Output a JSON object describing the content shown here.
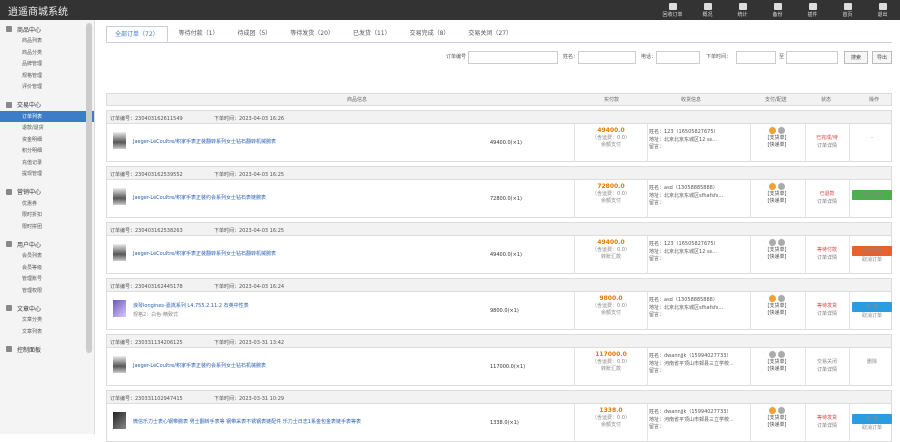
{
  "app_title": "逍遥商城系统",
  "topnav": [
    "回收订单",
    "概况",
    "统计",
    "备份",
    "插件",
    "首页",
    "退出"
  ],
  "sidebar": [
    {
      "title": "商品中心",
      "items": [
        "商品列表",
        "商品分类",
        "品牌管理",
        "规格管理",
        "评价管理"
      ]
    },
    {
      "title": "交易中心",
      "items": [
        "订单列表",
        "退款/退货",
        "资金明细",
        "积分明细",
        "充值记录",
        "提现管理"
      ]
    },
    {
      "title": "营销中心",
      "items": [
        "优惠券",
        "限时折扣",
        "限时拼团"
      ]
    },
    {
      "title": "用户中心",
      "items": [
        "会员列表",
        "会员等级",
        "管理账号",
        "管理权限"
      ]
    },
    {
      "title": "文章中心",
      "items": [
        "文章分类",
        "文章列表"
      ]
    },
    {
      "title": "控制面板",
      "items": []
    }
  ],
  "tabs": [
    "全部订单（72）",
    "等待付款（1）",
    "待成团（5）",
    "等待发货（20）",
    "已发货（11）",
    "交易完成（8）",
    "交易关闭（27）"
  ],
  "filters": {
    "order_no": "订单编号",
    "name": "姓名：",
    "phone": "电话：",
    "time": "下单时间：",
    "to": "至",
    "search": "搜索",
    "export": "导出"
  },
  "table_headers": [
    "商品信息",
    "实付款",
    "收货信息",
    "支付/配送",
    "状态",
    "操作"
  ],
  "orders": [
    {
      "no": "订单编号：230403162611549",
      "time": "下单时间：2023-04-03 16:26",
      "product": "Jaeger-LeCoultre/积家手表正装翻转系列女士钻石翻转机械腕表",
      "variant": "",
      "qty": "49400.0(×1)",
      "paid": "49400.0",
      "sub1": "（含运费：0.0）",
      "sub2": "余额支付",
      "addr": [
        "姓名：123（16505827675）",
        "地址：北京北京东城区12 ss...",
        "留言："
      ],
      "pay_icons": [
        "o",
        "g"
      ],
      "pay": [
        "[支货单]",
        "[快递单]"
      ],
      "status": "已完成/待",
      "status_sub": "订单详情",
      "op": "-",
      "op_color": "",
      "op_sub": "",
      "thumb": "w"
    },
    {
      "no": "订单编号：230403162539552",
      "time": "下单时间：2023-04-03 16:25",
      "product": "Jaeger-LeCoultre/积家手表正装约会系列女士钻石表链腕表",
      "variant": "",
      "qty": "72800.0(×1)",
      "paid": "72800.0",
      "sub1": "（含运费：0.0）",
      "sub2": "余额支付",
      "addr": [
        "姓名：asd（13058885888）",
        "地址：北京北京东城区sfhafsfs...",
        "留言："
      ],
      "pay_icons": [
        "o",
        "g"
      ],
      "pay": [
        "[支货单]",
        "[快递单]"
      ],
      "status": "已退款",
      "status_sub": "订单详情",
      "op": "确认回款",
      "op_color": "#4cae4c",
      "op_sub": "",
      "thumb": "w"
    },
    {
      "no": "订单编号：230403162538263",
      "time": "下单时间：2023-04-03 16:25",
      "product": "Jaeger-LeCoultre/积家手表正装翻转系列女士钻石翻转机械腕表",
      "variant": "",
      "qty": "49400.0(×1)",
      "paid": "49400.0",
      "sub1": "（含运费：0.0）",
      "sub2": "转账汇款",
      "addr": [
        "姓名：123（16505827675）",
        "地址：北京北京东城区12 ss...",
        "留言："
      ],
      "pay_icons": [
        "g",
        "g"
      ],
      "pay": [
        "[支货单]",
        "[快递单]"
      ],
      "status": "等待付款",
      "status_sub": "订单详情",
      "op": "立即付款",
      "op_color": "#e8602c",
      "op_sub": "取消订单",
      "thumb": "w"
    },
    {
      "no": "订单编号：230403162445178",
      "time": "下单时间：2023-04-03 16:24",
      "product": "浪琴longines-嘉岚系列 L4.755.2.11.2 石英中性表",
      "variant": "规格2：白色-精致式",
      "qty": "9800.0(×1)",
      "paid": "9800.0",
      "sub1": "（含运费：0.0）",
      "sub2": "余额支付",
      "addr": [
        "姓名：asd（13058885888）",
        "地址：北京北京东城区sfhafsfs...",
        "留言："
      ],
      "pay_icons": [
        "o",
        "g"
      ],
      "pay": [
        "[支货单]",
        "[快递单]"
      ],
      "status": "等待发货",
      "status_sub": "订单详情",
      "op": "发 货",
      "op_color": "#2a9de0",
      "op_sub": "取消订单",
      "thumb": "c"
    },
    {
      "no": "订单编号：230331134206125",
      "time": "下单时间：2023-03-31 13:42",
      "product": "Jaeger-LeCoultre/积家手表正装约会系列女士钻石机械腕表",
      "variant": "",
      "qty": "117000.0(×1)",
      "paid": "117000.0",
      "sub1": "（含运费：0.0）",
      "sub2": "转账汇款",
      "addr": [
        "姓名：dwannjjk（15994027733）",
        "地址：河南省平顶山市郏县三立学校...",
        "留言："
      ],
      "pay_icons": [
        "g",
        "g"
      ],
      "pay": [
        "[支货单]",
        "[快递单]"
      ],
      "status": "交易关闭",
      "status_sub": "订单详情",
      "op": "删除",
      "op_color": "",
      "op_sub": "",
      "thumb": "w"
    },
    {
      "no": "订单编号：230331102947415",
      "time": "下单时间：2023-03-31 10:29",
      "product": "微信乐力士表心钢带腕表 男士翻转手表等 钢带采表不锈钢表链配件 乐力士日志1系金包金表链手表等表",
      "variant": "",
      "qty": "1338.0(×1)",
      "paid": "1338.0",
      "sub1": "（含运费：0.0）",
      "sub2": "余额支付",
      "addr": [
        "姓名：dwannjjk（15994027733）",
        "地址：河南省平顶山市郏县三立学校...",
        "留言："
      ],
      "pay_icons": [
        "o",
        "g"
      ],
      "pay": [
        "[支货单]",
        "[快递单]"
      ],
      "status": "等待发货",
      "status_sub": "订单详情",
      "op": "发 货",
      "op_color": "#2a9de0",
      "op_sub": "取消订单",
      "thumb": "d"
    }
  ]
}
